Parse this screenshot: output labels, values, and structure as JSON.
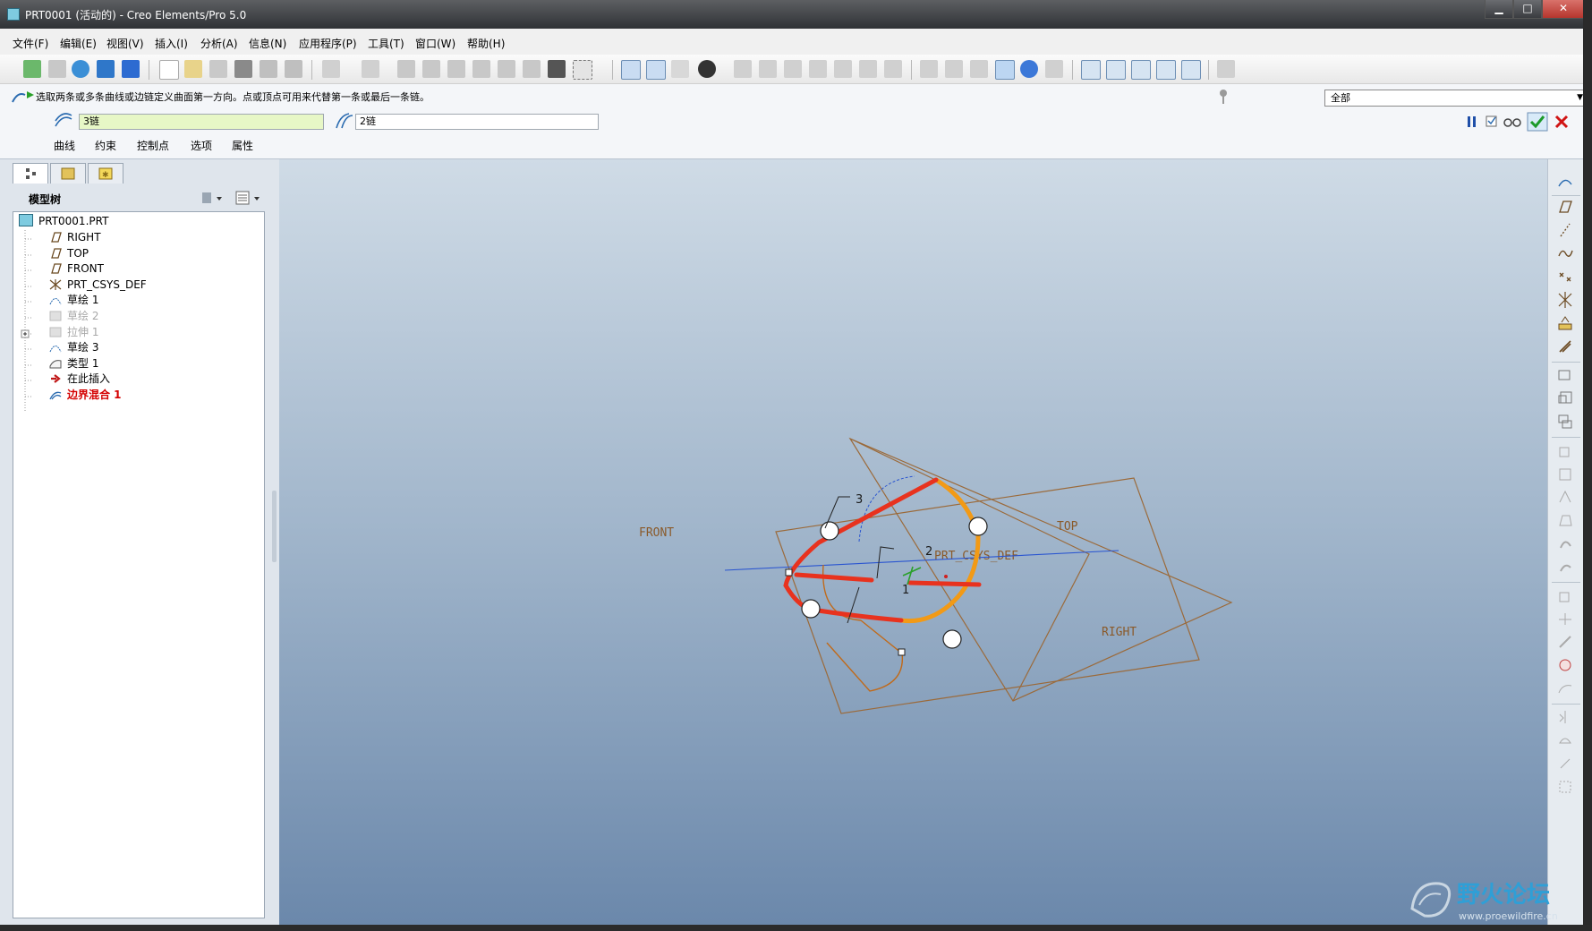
{
  "window": {
    "title": "PRT0001 (活动的) - Creo Elements/Pro 5.0",
    "min": "▁",
    "max": "□",
    "close": "✕"
  },
  "menu": [
    "文件(F)",
    "编辑(E)",
    "视图(V)",
    "插入(I)",
    "分析(A)",
    "信息(N)",
    "应用程序(P)",
    "工具(T)",
    "窗口(W)",
    "帮助(H)"
  ],
  "dashboard": {
    "message": "选取两条或多条曲线或边链定义曲面第一方向。点或顶点可用来代替第一条或最后一条链。",
    "chain1": "3链",
    "chain2": "2链",
    "tabs": [
      "曲线",
      "约束",
      "控制点",
      "选项",
      "属性"
    ],
    "filter": "全部"
  },
  "panel": {
    "tree_label": "模型树"
  },
  "tree": [
    {
      "label": "PRT0001.PRT",
      "icon": "part-icon",
      "state": "normal"
    },
    {
      "label": "RIGHT",
      "icon": "datum-plane-icon",
      "state": "normal"
    },
    {
      "label": "TOP",
      "icon": "datum-plane-icon",
      "state": "normal"
    },
    {
      "label": "FRONT",
      "icon": "datum-plane-icon",
      "state": "normal"
    },
    {
      "label": "PRT_CSYS_DEF",
      "icon": "csys-icon",
      "state": "normal"
    },
    {
      "label": "草绘 1",
      "icon": "sketch-icon",
      "state": "normal"
    },
    {
      "label": "草绘 2",
      "icon": "sketch-icon",
      "state": "dim"
    },
    {
      "label": "拉伸 1",
      "icon": "extrude-icon",
      "state": "dim"
    },
    {
      "label": "草绘 3",
      "icon": "sketch-icon",
      "state": "normal"
    },
    {
      "label": "类型 1",
      "icon": "surface-icon",
      "state": "normal"
    },
    {
      "label": "在此插入",
      "icon": "insert-here-icon",
      "state": "insert"
    },
    {
      "label": "边界混合 1",
      "icon": "boundary-blend-icon",
      "state": "active"
    }
  ],
  "viewport": {
    "labels": {
      "front": "FRONT",
      "top": "TOP",
      "right": "RIGHT",
      "csys": "PRT_CSYS_DEF",
      "n1": "1",
      "n2": "2",
      "n3": "3"
    },
    "colors": {
      "red": "#e8321e",
      "orange": "#f29a16",
      "datum": "#9b6a3a",
      "axis": "#2a55d0"
    }
  },
  "watermark": {
    "text": "野火论坛",
    "url": "www.proewildfire.cn"
  }
}
